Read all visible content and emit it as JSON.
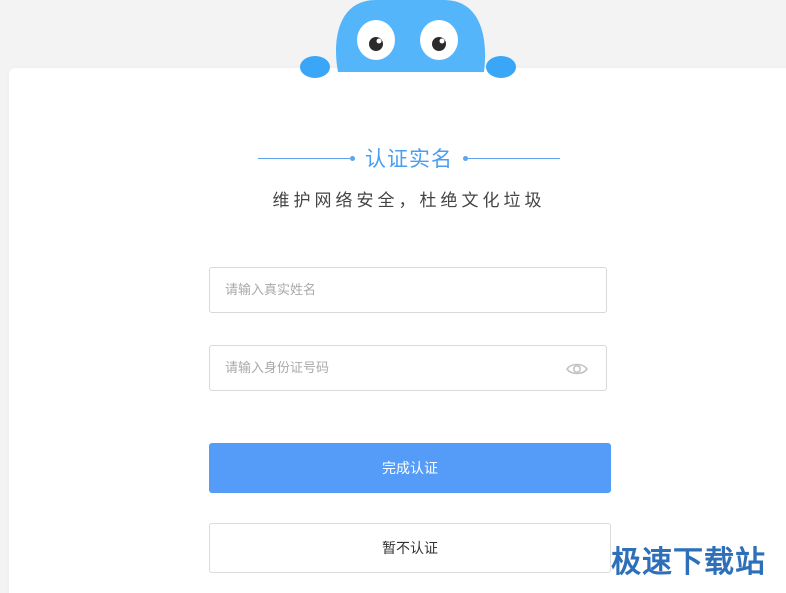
{
  "dialog": {
    "title": "认证实名",
    "subtitle": "维护网络安全，杜绝文化垃圾"
  },
  "form": {
    "name_placeholder": "请输入真实姓名",
    "id_placeholder": "请输入身份证号码",
    "submit_label": "完成认证",
    "skip_label": "暂不认证"
  },
  "watermark": "极速下载站",
  "colors": {
    "accent": "#4a9ff0",
    "primary_button": "#559cf9",
    "mascot": "#55b5fb",
    "background": "#f3f3f3"
  },
  "icons": {
    "password_toggle": "eye-icon",
    "mascot": "mascot-illustration"
  }
}
